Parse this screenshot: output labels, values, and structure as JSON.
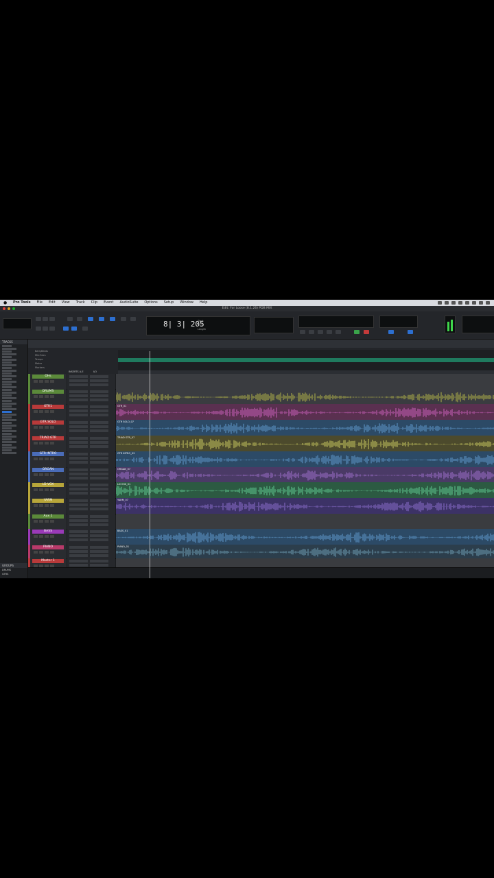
{
  "menubar": {
    "app": "Pro Tools",
    "items": [
      "File",
      "Edit",
      "View",
      "Track",
      "Clip",
      "Event",
      "AudioSuite",
      "Options",
      "Setup",
      "Window",
      "Help"
    ]
  },
  "window": {
    "title": "Edit: For Loose (8.1.26) PDB MIX"
  },
  "counter": {
    "main": "8| 3| 205",
    "labels": [
      "Start",
      "End",
      "Length"
    ]
  },
  "sidebar": {
    "tracks_header": "TRACKS",
    "groups_header": "GROUPS",
    "groups": [
      "DRUMS",
      "GTRS"
    ]
  },
  "ruler_labels": [
    "Bars|Beats",
    "Min:Secs",
    "Tempo",
    "Meter",
    "Markers"
  ],
  "tracks": [
    {
      "name": "OHs",
      "color": "#5b8a3a",
      "clip": "",
      "lane": "#3a3c40",
      "wave": "",
      "h": 22
    },
    {
      "name": "DRUMS",
      "color": "#5b8a3a",
      "clip": "",
      "lane": "#3a3c40",
      "wave": "#c8c84a",
      "h": 22
    },
    {
      "name": "GTR1",
      "color": "#b83a3a",
      "clip": "GTR_01",
      "lane": "#5a3050",
      "wave": "#e06ad0",
      "h": 23
    },
    {
      "name": "GTR SOLO",
      "color": "#b83a3a",
      "clip": "GTR SOLO_07",
      "lane": "#2c4a66",
      "wave": "#6aa8e0",
      "h": 23
    },
    {
      "name": "TRIAD GTR",
      "color": "#b83a3a",
      "clip": "TRIAD GTR_07",
      "lane": "#4c4a2c",
      "wave": "#e0e06a",
      "h": 23
    },
    {
      "name": "GTR INTRO",
      "color": "#4a6cb8",
      "clip": "GTR INTRO_09",
      "lane": "#2c4a66",
      "wave": "#6aa8e0",
      "h": 23
    },
    {
      "name": "ORGAN",
      "color": "#4a6cb8",
      "clip": "ORGAN_07",
      "lane": "#4a3a66",
      "wave": "#b07ae0",
      "h": 22
    },
    {
      "name": "LD VOX",
      "color": "#b8a63a",
      "clip": "LD VOX_01",
      "lane": "#2c5a42",
      "wave": "#6ae0a0",
      "h": 23
    },
    {
      "name": "YARM",
      "color": "#b8a63a",
      "clip": "YARM_07",
      "lane": "#3c3266",
      "wave": "#9a7ae0",
      "h": 23
    },
    {
      "name": "Aux 1",
      "color": "#5b8a3a",
      "clip": "",
      "lane": "#3a3c40",
      "wave": "",
      "h": 22
    },
    {
      "name": "BASS",
      "color": "#9a3ab8",
      "clip": "BASS_01",
      "lane": "#2c4a66",
      "wave": "#6aa8e0",
      "h": 23
    },
    {
      "name": "PIANO",
      "color": "#b83a6a",
      "clip": "PIANO_01",
      "lane": "#2c3e4c",
      "wave": "#7ab0c8",
      "h": 20
    },
    {
      "name": "Master 1",
      "color": "#b83a3a",
      "clip": "",
      "lane": "#3a3c40",
      "wave": "",
      "h": 13
    }
  ],
  "io": {
    "insert_label": "INSERTS A-E",
    "io_label": "I/O"
  }
}
